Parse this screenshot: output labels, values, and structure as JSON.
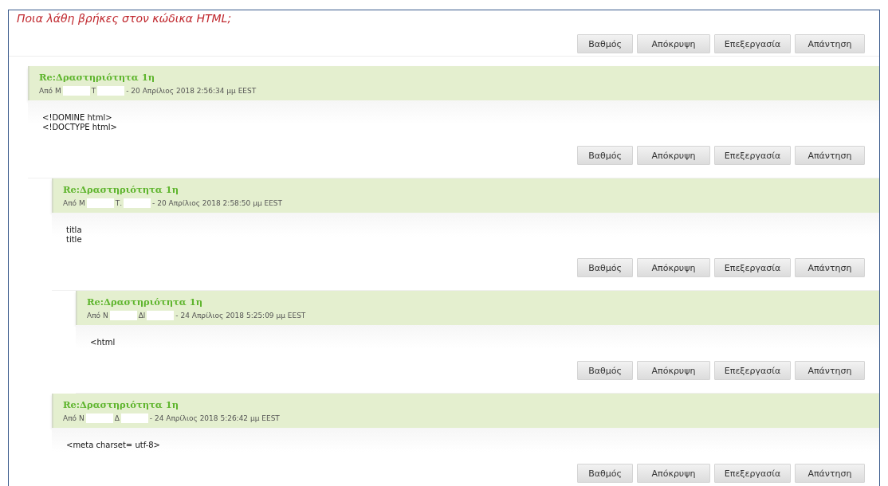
{
  "question": "Ποια λάθη βρήκες στον κώδικα HTML;",
  "actions": [
    "Βαθμός",
    "Απόκρυψη",
    "Επεξεργασία",
    "Απάντηση"
  ],
  "posts": [
    {
      "title": "Re:Δραστηριότητα 1η",
      "byline": [
        "Από Μ",
        "Τ",
        "- 20 Απρίλιος 2018 2:56:34 μμ EEST"
      ],
      "body": [
        "<!DOMINE html>",
        "<!DOCTYPE html>"
      ],
      "actions": [
        "Βαθμός",
        "Απόκρυψη",
        "Επεξεργασία",
        "Απάντηση"
      ],
      "children": [
        {
          "title": "Re:Δραστηριότητα 1η",
          "byline": [
            "Από Μ",
            "Τ.",
            "- 20 Απρίλιος 2018 2:58:50 μμ EEST"
          ],
          "body": [
            "titla",
            "title"
          ],
          "actions": [
            "Βαθμός",
            "Απόκρυψη",
            "Επεξεργασία",
            "Απάντηση"
          ],
          "children": [
            {
              "title": "Re:Δραστηριότητα 1η",
              "byline": [
                "Από Ν",
                "Δl",
                "- 24 Απρίλιος 2018 5:25:09 μμ EEST"
              ],
              "body": [
                "<html"
              ],
              "actions": [
                "Βαθμός",
                "Απόκρυψη",
                "Επεξεργασία",
                "Απάντηση"
              ]
            }
          ]
        },
        {
          "title": "Re:Δραστηριότητα 1η",
          "byline": [
            "Από Ν",
            "Δ",
            "- 24 Απρίλιος 2018 5:26:42 μμ EEST"
          ],
          "body": [
            "<meta charset= utf-8>"
          ],
          "actions": [
            "Βαθμός",
            "Απόκρυψη",
            "Επεξεργασία",
            "Απάντηση"
          ]
        }
      ]
    }
  ]
}
